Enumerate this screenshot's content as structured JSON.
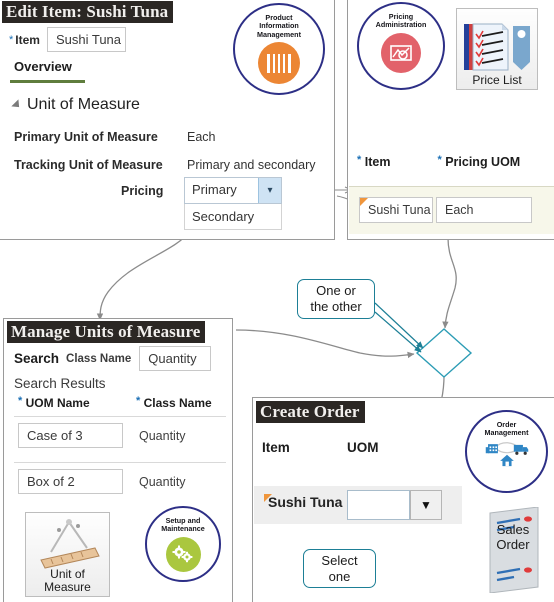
{
  "edit_item": {
    "title": "Edit Item: Sushi Tuna",
    "item_label": "Item",
    "item_value": "Sushi Tuna",
    "tab": "Overview",
    "section": "Unit of Measure",
    "rows": [
      {
        "label": "Primary Unit of Measure",
        "value": "Each"
      },
      {
        "label": "Tracking Unit of Measure",
        "value": "Primary and secondary"
      }
    ],
    "pricing_label": "Pricing",
    "pricing_selected": "Primary",
    "pricing_option": "Secondary",
    "dropdown_icon": "chevron-down-icon",
    "app_icon": {
      "name": "product-information-management-icon",
      "line1": "Product",
      "line2": "Information",
      "line3": "Management",
      "color": "#ec8634"
    }
  },
  "pricing_admin": {
    "app_icon": {
      "name": "pricing-administration-icon",
      "line1": "Pricing",
      "line2": "Administration",
      "color": "#e2626a"
    },
    "price_list_icon_label": "Price List",
    "col_item": "Item",
    "col_pricing_uom": "Pricing UOM",
    "row": {
      "item": "Sushi Tuna",
      "pricing_uom": "Each"
    }
  },
  "manage_uom": {
    "title": "Manage Units of Measure",
    "search_label": "Search",
    "class_name_label": "Class Name",
    "class_name_value": "Quantity",
    "search_results_label": "Search Results",
    "columns": [
      "UOM Name",
      "Class Name"
    ],
    "rows": [
      {
        "uom_name": "Case of 3",
        "class_name": "Quantity"
      },
      {
        "uom_name": "Box of 2",
        "class_name": "Quantity"
      }
    ],
    "uom_icon_label_1": "Unit of",
    "uom_icon_label_2": "Measure",
    "app_icon": {
      "name": "setup-and-maintenance-icon",
      "line1": "Setup and",
      "line2": "Maintenance",
      "color": "#aac73f"
    }
  },
  "create_order": {
    "title": "Create Order",
    "columns": [
      "Item",
      "UOM"
    ],
    "row": {
      "item": "Sushi Tuna",
      "uom": ""
    },
    "dropdown_icon": "triangle-down-icon",
    "app_icon": {
      "name": "order-management-icon",
      "line1": "Order",
      "line2": "Management"
    },
    "sales_order_icon_label_1": "Sales",
    "sales_order_icon_label_2": "Order"
  },
  "callouts": {
    "one_or_the_other_line1": "One or",
    "one_or_the_other_line2": "the other",
    "select_one_line1": "Select",
    "select_one_line2": "one"
  },
  "colors": {
    "title_bar_bg": "#2b2724",
    "callout_border": "#1d7f96",
    "connector": "#8b8b8b",
    "required_star": "#1a6fb5",
    "tab_underline": "#5f7d3d",
    "decision_diamond": "#2c9cb5"
  }
}
